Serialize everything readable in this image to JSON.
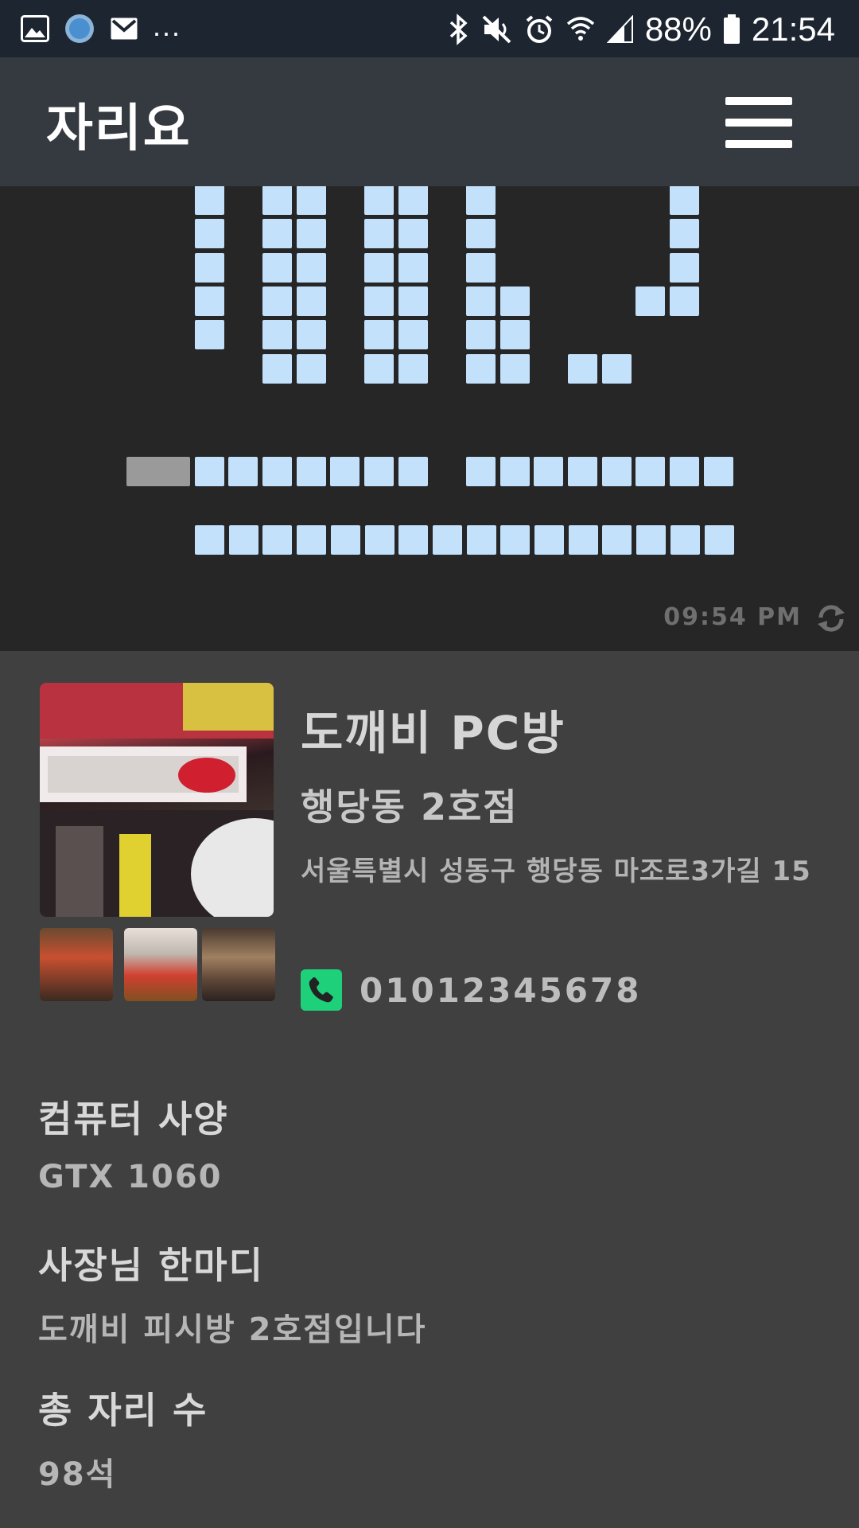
{
  "status_bar": {
    "battery": "88%",
    "time": "21:54",
    "more_indicator": "...",
    "left_icons": [
      "image-icon",
      "circle-app-icon",
      "gmail-icon"
    ],
    "right_icons": [
      "bluetooth-icon",
      "mute-icon",
      "alarm-icon",
      "wifi-icon",
      "signal-icon",
      "battery-icon"
    ]
  },
  "app_bar": {
    "title": "자리요",
    "menu_icon": "hamburger-menu-icon"
  },
  "seat_map": {
    "updated_time": "09:54 PM",
    "refresh_icon": "refresh-icon",
    "colors": {
      "available": "#c4e1fc",
      "occupied": "#9a9a9a",
      "background": "#262626"
    }
  },
  "shop": {
    "name": "도깨비 PC방",
    "branch": "행당동 2호점",
    "address": "서울특별시 성동구 행당동 마조로3가길 15",
    "phone": "01012345678",
    "phone_icon": "phone-icon",
    "phone_icon_color": "#1fd07a"
  },
  "details": {
    "computer_spec_title": "컴퓨터 사양",
    "computer_spec_value": "GTX 1060",
    "owner_message_title": "사장님 한마디",
    "owner_message_value": "도깨비 피시방 2호점입니다",
    "total_seats_title": "총 자리 수",
    "total_seats_value": "98석"
  }
}
